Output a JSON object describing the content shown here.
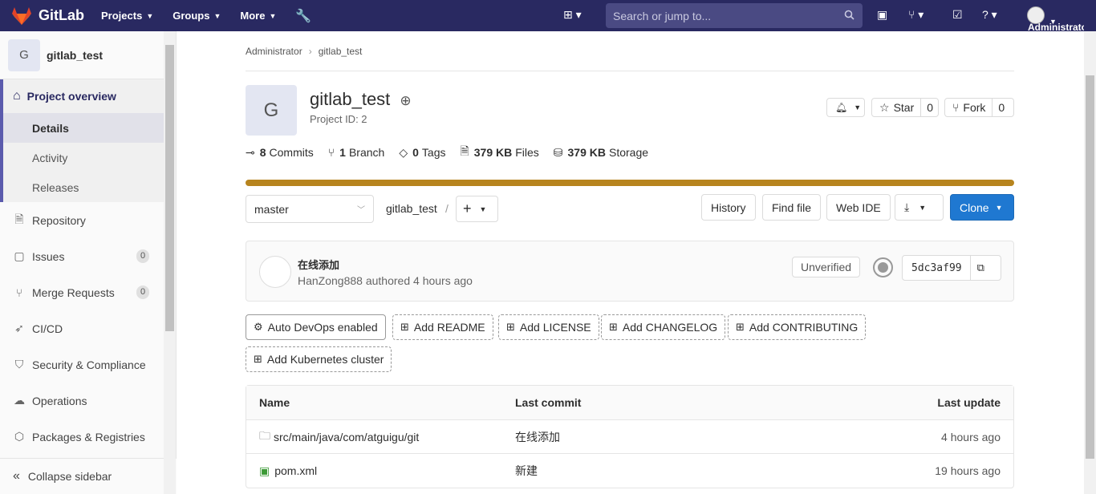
{
  "topnav": {
    "brand": "GitLab",
    "projects": "Projects",
    "groups": "Groups",
    "more": "More",
    "search_placeholder": "Search or jump to...",
    "user": "Administrator"
  },
  "sidebar": {
    "project_letter": "G",
    "project_name": "gitlab_test",
    "overview": "Project overview",
    "overview_items": [
      "Details",
      "Activity",
      "Releases"
    ],
    "items": [
      {
        "label": "Repository"
      },
      {
        "label": "Issues",
        "badge": "0"
      },
      {
        "label": "Merge Requests",
        "badge": "0"
      },
      {
        "label": "CI/CD"
      },
      {
        "label": "Security & Compliance"
      },
      {
        "label": "Operations"
      },
      {
        "label": "Packages & Registries"
      }
    ],
    "collapse": "Collapse sidebar"
  },
  "breadcrumb": [
    "Administrator",
    "gitlab_test"
  ],
  "project": {
    "letter": "G",
    "title": "gitlab_test",
    "id": "Project ID: 2",
    "star": "Star",
    "star_count": "0",
    "fork": "Fork",
    "fork_count": "0"
  },
  "stats": {
    "commits_n": "8",
    "commits": "Commits",
    "branch_n": "1",
    "branch": "Branch",
    "tags_n": "0",
    "tags": "Tags",
    "files_n": "379 KB",
    "files": "Files",
    "storage_n": "379 KB",
    "storage": "Storage"
  },
  "tree": {
    "branch": "master",
    "path": "gitlab_test",
    "sep": "/",
    "history": "History",
    "find_file": "Find file",
    "web_ide": "Web IDE",
    "clone": "Clone"
  },
  "commit": {
    "message": "在线添加",
    "author": "HanZong888",
    "authored": "authored",
    "time": "4 hours ago",
    "verified": "Unverified",
    "sha": "5dc3af99"
  },
  "actions": {
    "autodevops": "Auto DevOps enabled",
    "readme": "Add README",
    "license": "Add LICENSE",
    "changelog": "Add CHANGELOG",
    "contributing": "Add CONTRIBUTING",
    "k8s": "Add Kubernetes cluster"
  },
  "table": {
    "headers": [
      "Name",
      "Last commit",
      "Last update"
    ],
    "rows": [
      {
        "name": "src/main/java/com/atguigu/git",
        "commit": "在线添加",
        "update": "4 hours ago"
      },
      {
        "name": "pom.xml",
        "commit": "新建",
        "update": "19 hours ago"
      }
    ]
  },
  "colors": {
    "nav": "#292961",
    "accent": "#1f78d1",
    "storage_bar": "#b7841e"
  }
}
